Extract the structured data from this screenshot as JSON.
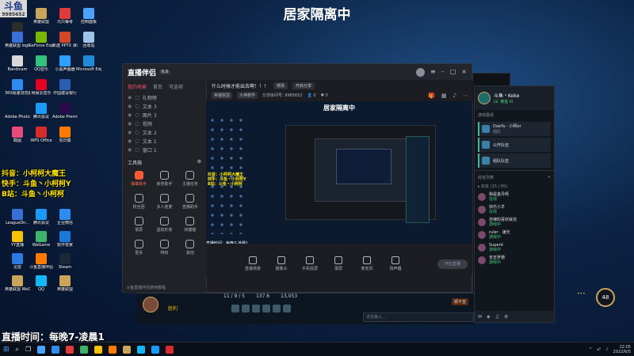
{
  "headline": "居家隔离中",
  "logo": {
    "main": "斗鱼",
    "sub": "9985652"
  },
  "desktop_icons": [
    {
      "label": "斗鱼",
      "color": "#2c2c2c"
    },
    {
      "label": "英雄联盟",
      "color": "#c9a45a"
    },
    {
      "label": "元只每考",
      "color": "#e03a3a"
    },
    {
      "label": "控制面板",
      "color": "#4aa3ff"
    },
    {
      "label": "英雄联盟 login",
      "color": "#3a6fd8"
    },
    {
      "label": "GeForce Experience",
      "color": "#76b900"
    },
    {
      "label": "新建 PPTX 演示文稿",
      "color": "#d24726"
    },
    {
      "label": "回收站",
      "color": "#9fc4e8"
    },
    {
      "label": "Bandicam",
      "color": "#d8d8d8"
    },
    {
      "label": "QQ音乐",
      "color": "#31c27c"
    },
    {
      "label": "小黑声画器",
      "color": "#2da0ff"
    },
    {
      "label": "Microsoft Edge",
      "color": "#1f8bd6"
    },
    {
      "label": "360极速浏览器",
      "color": "#2d8cf0"
    },
    {
      "label": "网易云音乐",
      "color": "#e60026"
    },
    {
      "label": "中国建设银行",
      "color": "#2a5fb3"
    },
    {
      "label": "Adobe Photosh...",
      "color": "#001e36"
    },
    {
      "label": "腾讯会议",
      "color": "#1a9bfc"
    },
    {
      "label": "Adobe Premie...",
      "color": "#2a0a4a"
    },
    {
      "label": "截图",
      "color": "#e84a7a"
    },
    {
      "label": "WPS Office",
      "color": "#d92b2b"
    },
    {
      "label": "向日葵",
      "color": "#ff7a00"
    },
    {
      "label": "LeagueDir...",
      "color": "#3a6fd8"
    },
    {
      "label": "腾讯会议",
      "color": "#1a9bfc"
    },
    {
      "label": "企业微信",
      "color": "#2d8cf0"
    },
    {
      "label": "YY直播",
      "color": "#f7c300"
    },
    {
      "label": "WeGame",
      "color": "#3fb26b"
    },
    {
      "label": "软件管家",
      "color": "#1a78d8"
    },
    {
      "label": "迅雷",
      "color": "#2a7ae2"
    },
    {
      "label": "斗鱼直播伴侣",
      "color": "#ff7a00"
    },
    {
      "label": "Steam",
      "color": "#1b2838"
    },
    {
      "label": "英雄联盟 WeGame版",
      "color": "#c9a45a"
    },
    {
      "label": "QQ",
      "color": "#12b7f5"
    },
    {
      "label": "英雄联盟",
      "color": "#c9a45a"
    }
  ],
  "overlay": {
    "line1": "抖音：小柯柯大魔王",
    "line2": "快手：斗鱼丶小柯柯Y",
    "line3": "B站：斗鱼丶小柯柯",
    "bottom": "直播时间：每晚7-凌晨1"
  },
  "app": {
    "brand": "直播伴侣",
    "badge": "6.9",
    "tabs": [
      "我的场景",
      "首页",
      "可选项"
    ],
    "scenes": [
      {
        "name": "礼物榜"
      },
      {
        "name": "文本 3"
      },
      {
        "name": "图片 3"
      },
      {
        "name": "视频"
      },
      {
        "name": "文本 2"
      },
      {
        "name": "文本 1"
      },
      {
        "name": "窗口 1"
      }
    ],
    "tools_title": "工具箱",
    "tools": [
      {
        "label": "弹幕助手",
        "hot": true
      },
      {
        "label": "房管助手",
        "hot": false
      },
      {
        "label": "主播任务",
        "hot": false
      },
      {
        "label": "粉丝团",
        "hot": false
      },
      {
        "label": "多人连麦",
        "hot": false
      },
      {
        "label": "直播助手",
        "hot": false
      },
      {
        "label": "录屏",
        "hot": false
      },
      {
        "label": "虚拟形象",
        "hot": false
      },
      {
        "label": "快捷键",
        "hot": false
      },
      {
        "label": "更多",
        "hot": false
      },
      {
        "label": "特效",
        "hot": false
      },
      {
        "label": "其他",
        "hot": false
      }
    ],
    "lp_footer": "斗鱼直播伴侣使用教程",
    "live_title": "什么时候才能出去啊！！！",
    "btn_edit": "修改",
    "btn_share": "开启分享",
    "tags": [
      "英雄联盟",
      "大神教学"
    ],
    "room_info": "分享房间号: 9985652",
    "online": "0",
    "likes": "0",
    "preview_title": "居家隔离中",
    "live_notice": "直播时间：每晚7-凌晨1",
    "live_msg": "直播时间：每晚7-凌晨1",
    "preview_tools": [
      {
        "label": "直播场景"
      },
      {
        "label": "摄像头"
      },
      {
        "label": "手机投屏"
      },
      {
        "label": "录屏"
      },
      {
        "label": "麦克风"
      },
      {
        "label": "扬声器"
      }
    ],
    "start_live": "开始直播"
  },
  "game": {
    "stats": [
      "11 / 9 / 5",
      "137.6",
      "13,053"
    ],
    "result": "胜利",
    "mini_label": "顺不直",
    "chat_placeholder": "点击输入..."
  },
  "social": {
    "username": "斗鱼丶Koke",
    "level_text": "LV. 黄金 III",
    "section": "游戏邀请",
    "cards": [
      {
        "name": "DoeYu · 小柯er",
        "sub": "组队"
      },
      {
        "name": "公开队伍",
        "sub": ""
      },
      {
        "name": "组队队伍",
        "sub": ""
      }
    ],
    "friends_head": "好友列表",
    "group": "▸ 好友 (15 / 65)",
    "friends": [
      {
        "name": "我是金丹呀",
        "status": "在线"
      },
      {
        "name": "快乐小羊",
        "status": "在线"
      },
      {
        "name": "自律的喜欢就完",
        "status": "游戏中"
      },
      {
        "name": "ruler · 谦光",
        "status": "游戏中"
      },
      {
        "name": "Superd",
        "status": "游戏中"
      },
      {
        "name": "安吉罗德",
        "status": "游戏中"
      }
    ]
  },
  "level_badge": "48",
  "taskbar": {
    "time": "22:05",
    "date": "2022/6/5",
    "icon_colors": [
      "#4aa3ff",
      "#2d8cf0",
      "#e03a3a",
      "#3fb26b",
      "#f7c300",
      "#ff7a00",
      "#c9a45a",
      "#12b7f5",
      "#1a9bfc",
      "#d92b2b"
    ]
  }
}
